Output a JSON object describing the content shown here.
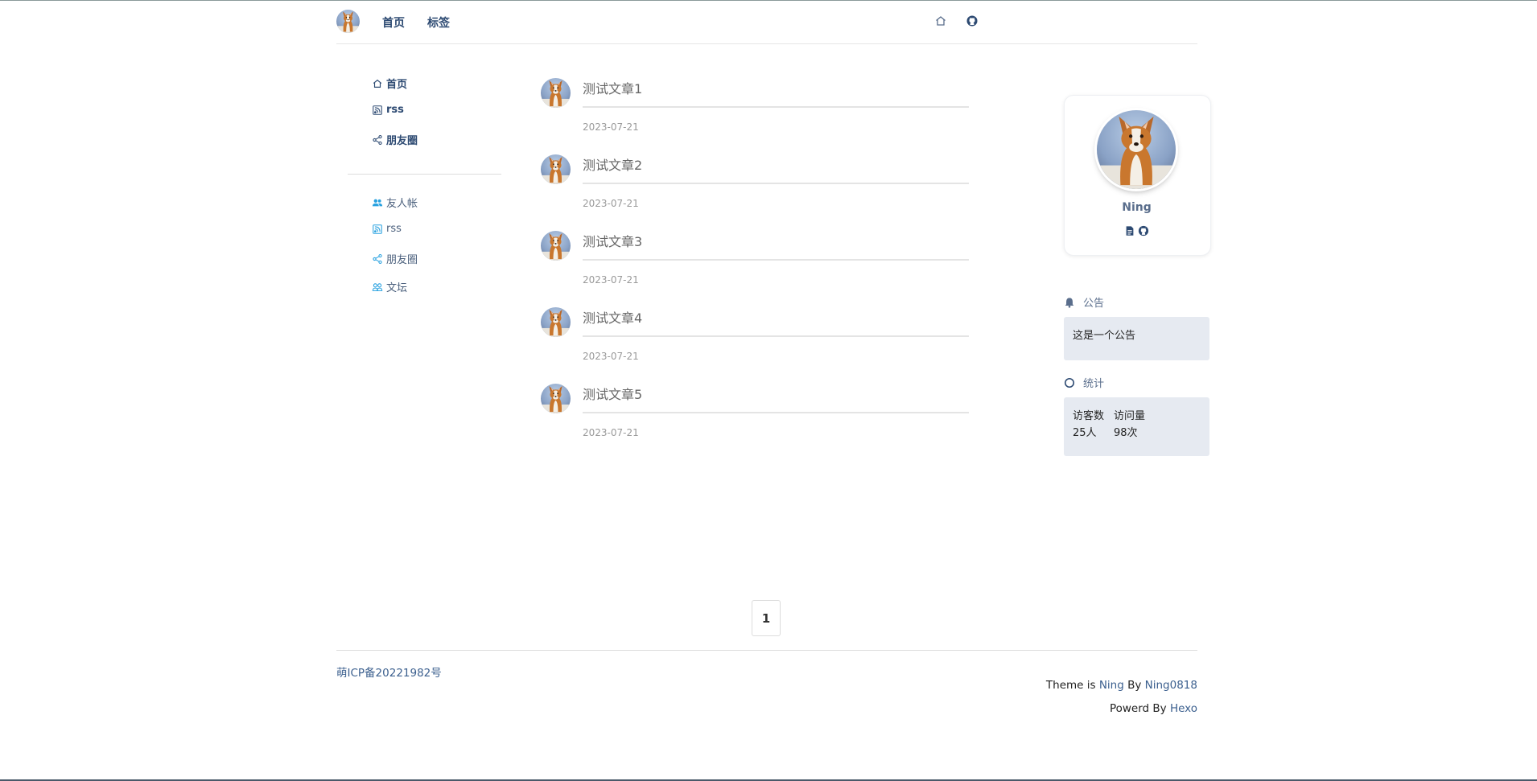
{
  "nav": {
    "links": [
      "首页",
      "标签"
    ],
    "icons": [
      "home-icon",
      "github-icon"
    ]
  },
  "sidebar": {
    "primary": [
      {
        "label": "首页",
        "icon": "home-icon"
      },
      {
        "label": "rss",
        "icon": "rss-icon"
      },
      {
        "label": "朋友圈",
        "icon": "share-icon"
      }
    ],
    "secondary": [
      {
        "label": "友人帐",
        "icon": "users-icon"
      },
      {
        "label": "rss",
        "icon": "rss-icon"
      },
      {
        "label": "朋友圈",
        "icon": "share-icon"
      },
      {
        "label": "文坛",
        "icon": "group-icon"
      }
    ]
  },
  "posts": [
    {
      "title": "测试文章1",
      "date": "2023-07-21"
    },
    {
      "title": "测试文章2",
      "date": "2023-07-21"
    },
    {
      "title": "测试文章3",
      "date": "2023-07-21"
    },
    {
      "title": "测试文章4",
      "date": "2023-07-21"
    },
    {
      "title": "测试文章5",
      "date": "2023-07-21"
    }
  ],
  "profile": {
    "name": "Ning",
    "icons": [
      "document-icon",
      "github-icon"
    ]
  },
  "announcement": {
    "title": "公告",
    "text": "这是一个公告"
  },
  "stats": {
    "title": "统计",
    "visitors_label": "访客数",
    "visitors_value": "25人",
    "views_label": "访问量",
    "views_value": "98次"
  },
  "pagination": {
    "current": "1"
  },
  "footer": {
    "icp": "萌ICP备20221982号",
    "theme_prefix": "Theme is ",
    "theme_name": "Ning",
    "theme_by": " By ",
    "author": "Ning0818",
    "powered_prefix": "Powerd By ",
    "powered_name": "Hexo"
  },
  "colors": {
    "nav_link": "#2d4a72",
    "accent": "#3b5f8e",
    "box_bg": "#e6eaf1",
    "sidebar_icon_secondary": "#2aa2e0"
  }
}
